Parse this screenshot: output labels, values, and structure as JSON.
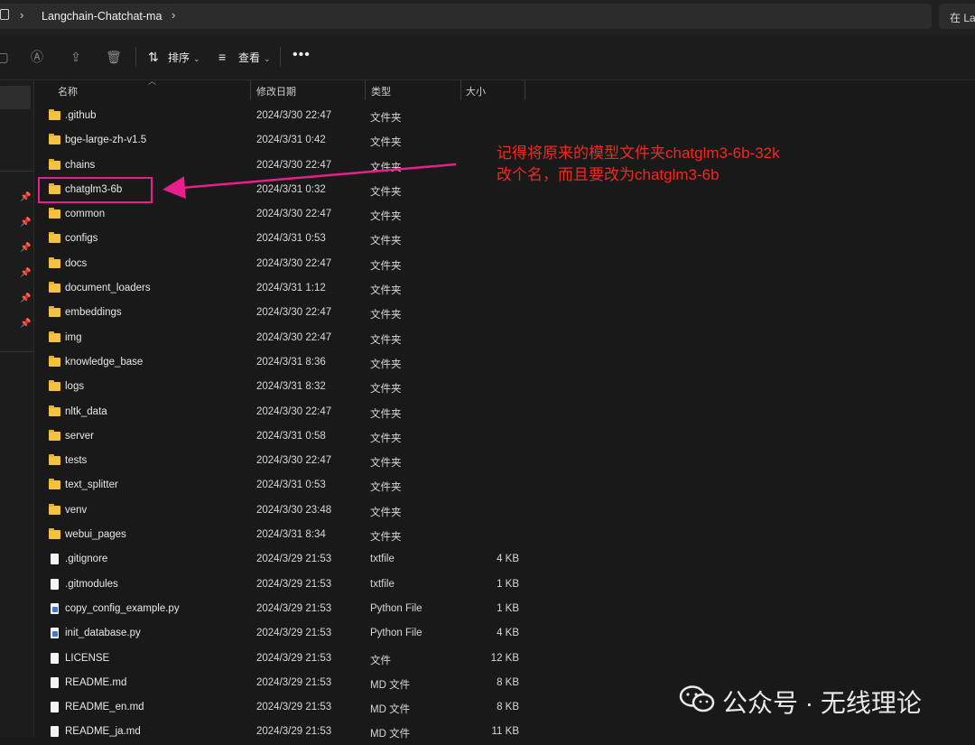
{
  "address_bar": {
    "separator": "›",
    "crumb": "Langchain-Chatchat-ma",
    "search_text": "在 La"
  },
  "command_bar": {
    "sort_label": "排序",
    "view_label": "查看",
    "more_label": "•••"
  },
  "columns": {
    "name": "名称",
    "date": "修改日期",
    "type": "类型",
    "size": "大小"
  },
  "files": [
    {
      "name": ".github",
      "date": "2024/3/30 22:47",
      "type": "文件夹",
      "size": "",
      "kind": "folder"
    },
    {
      "name": "bge-large-zh-v1.5",
      "date": "2024/3/31 0:42",
      "type": "文件夹",
      "size": "",
      "kind": "folder"
    },
    {
      "name": "chains",
      "date": "2024/3/30 22:47",
      "type": "文件夹",
      "size": "",
      "kind": "folder"
    },
    {
      "name": "chatglm3-6b",
      "date": "2024/3/31 0:32",
      "type": "文件夹",
      "size": "",
      "kind": "folder"
    },
    {
      "name": "common",
      "date": "2024/3/30 22:47",
      "type": "文件夹",
      "size": "",
      "kind": "folder"
    },
    {
      "name": "configs",
      "date": "2024/3/31 0:53",
      "type": "文件夹",
      "size": "",
      "kind": "folder"
    },
    {
      "name": "docs",
      "date": "2024/3/30 22:47",
      "type": "文件夹",
      "size": "",
      "kind": "folder"
    },
    {
      "name": "document_loaders",
      "date": "2024/3/31 1:12",
      "type": "文件夹",
      "size": "",
      "kind": "folder"
    },
    {
      "name": "embeddings",
      "date": "2024/3/30 22:47",
      "type": "文件夹",
      "size": "",
      "kind": "folder"
    },
    {
      "name": "img",
      "date": "2024/3/30 22:47",
      "type": "文件夹",
      "size": "",
      "kind": "folder"
    },
    {
      "name": "knowledge_base",
      "date": "2024/3/31 8:36",
      "type": "文件夹",
      "size": "",
      "kind": "folder"
    },
    {
      "name": "logs",
      "date": "2024/3/31 8:32",
      "type": "文件夹",
      "size": "",
      "kind": "folder"
    },
    {
      "name": "nltk_data",
      "date": "2024/3/30 22:47",
      "type": "文件夹",
      "size": "",
      "kind": "folder"
    },
    {
      "name": "server",
      "date": "2024/3/31 0:58",
      "type": "文件夹",
      "size": "",
      "kind": "folder"
    },
    {
      "name": "tests",
      "date": "2024/3/30 22:47",
      "type": "文件夹",
      "size": "",
      "kind": "folder"
    },
    {
      "name": "text_splitter",
      "date": "2024/3/31 0:53",
      "type": "文件夹",
      "size": "",
      "kind": "folder"
    },
    {
      "name": "venv",
      "date": "2024/3/30 23:48",
      "type": "文件夹",
      "size": "",
      "kind": "folder"
    },
    {
      "name": "webui_pages",
      "date": "2024/3/31 8:34",
      "type": "文件夹",
      "size": "",
      "kind": "folder"
    },
    {
      "name": ".gitignore",
      "date": "2024/3/29 21:53",
      "type": "txtfile",
      "size": "4 KB",
      "kind": "file"
    },
    {
      "name": ".gitmodules",
      "date": "2024/3/29 21:53",
      "type": "txtfile",
      "size": "1 KB",
      "kind": "file"
    },
    {
      "name": "copy_config_example.py",
      "date": "2024/3/29 21:53",
      "type": "Python File",
      "size": "1 KB",
      "kind": "py"
    },
    {
      "name": "init_database.py",
      "date": "2024/3/29 21:53",
      "type": "Python File",
      "size": "4 KB",
      "kind": "py"
    },
    {
      "name": "LICENSE",
      "date": "2024/3/29 21:53",
      "type": "文件",
      "size": "12 KB",
      "kind": "file"
    },
    {
      "name": "README.md",
      "date": "2024/3/29 21:53",
      "type": "MD 文件",
      "size": "8 KB",
      "kind": "file"
    },
    {
      "name": "README_en.md",
      "date": "2024/3/29 21:53",
      "type": "MD 文件",
      "size": "8 KB",
      "kind": "file"
    },
    {
      "name": "README_ja.md",
      "date": "2024/3/29 21:53",
      "type": "MD 文件",
      "size": "11 KB",
      "kind": "file"
    }
  ],
  "annotation": {
    "line1": "记得将原来的模型文件夹chatglm3-6b-32k",
    "line2": "改个名，而且要改为chatglm3-6b",
    "color": "#ee2a1f",
    "highlight_color": "#e91e8c"
  },
  "watermark": {
    "text": "公众号 · 无线理论"
  }
}
